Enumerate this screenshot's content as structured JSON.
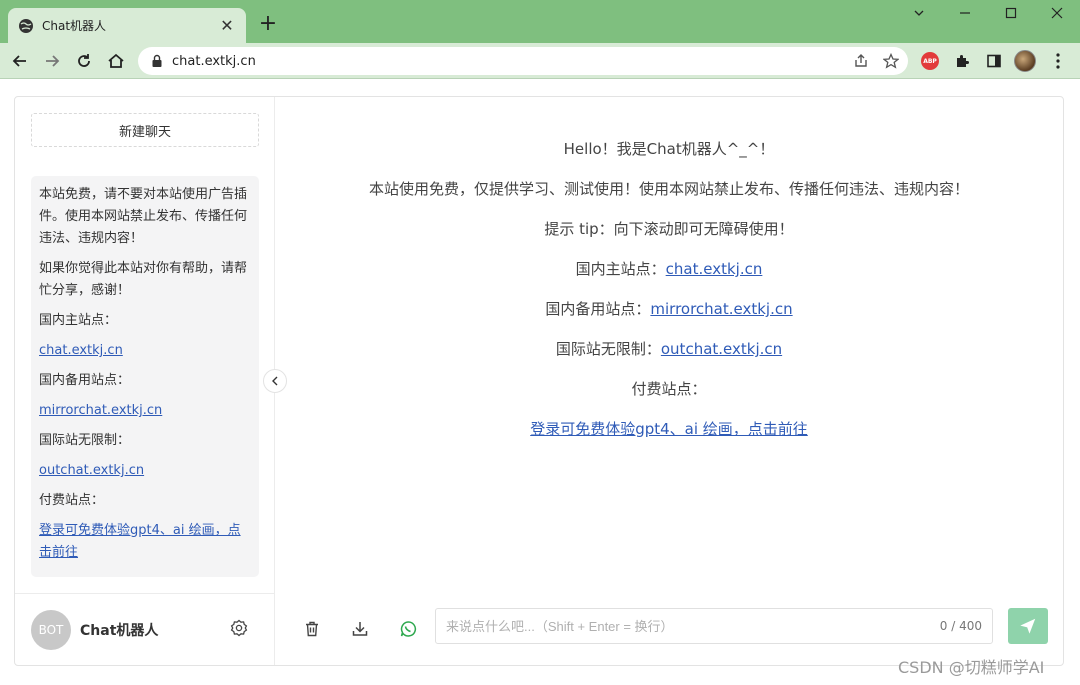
{
  "browser": {
    "tab_title": "Chat机器人",
    "new_tab_symbol": "+",
    "url": "chat.extkj.cn",
    "abp_label": "ABP"
  },
  "sidebar": {
    "new_chat_label": "新建聊天",
    "notice": {
      "p1": "本站免费，请不要对本站使用广告插件。使用本网站禁止发布、传播任何违法、违规内容！",
      "p2": "如果你觉得此本站对你有帮助，请帮忙分享，感谢！",
      "main_site_label": "国内主站点：",
      "main_site_link": "chat.extkj.cn",
      "backup_site_label": "国内备用站点：",
      "backup_site_link": "mirrorchat.extkj.cn",
      "intl_site_label": "国际站无限制：",
      "intl_site_link": "outchat.extkj.cn",
      "paid_site_label": "付费站点：",
      "paid_site_link": "登录可免费体验gpt4、ai 绘画，点击前往"
    },
    "avatar_text": "BOT",
    "bot_name": "Chat机器人"
  },
  "main": {
    "welcome": {
      "hello": "Hello！我是Chat机器人^_^！",
      "free_notice": "本站使用免费，仅提供学习、测试使用！使用本网站禁止发布、传播任何违法、违规内容！",
      "tip": "提示 tip：向下滚动即可无障碍使用！",
      "main_site_label": "国内主站点：",
      "main_site_link": "chat.extkj.cn",
      "backup_site_label": "国内备用站点：",
      "backup_site_link": "mirrorchat.extkj.cn",
      "intl_site_label": "国际站无限制：",
      "intl_site_link": "outchat.extkj.cn",
      "paid_site_label": "付费站点：",
      "paid_site_link": "登录可免费体验gpt4、ai 绘画，点击前往"
    },
    "input": {
      "placeholder": "来说点什么吧...（Shift + Enter = 换行）",
      "value": "",
      "counter": "0 / 400"
    }
  },
  "watermark": "CSDN @切糕师学AI",
  "colors": {
    "tabbar": "#7fbf7f",
    "toolbar": "#d8ebd6",
    "link": "#2f5bb7",
    "send_button": "#8fd3ab",
    "whatsapp_icon": "#2fa84f"
  },
  "icons": [
    "globe-icon",
    "close-icon",
    "minimize-icon",
    "maximize-icon",
    "chevron-down-icon",
    "back-icon",
    "forward-icon",
    "reload-icon",
    "home-icon",
    "lock-icon",
    "share-icon",
    "star-icon",
    "puzzle-icon",
    "sidepanel-icon",
    "menu-icon",
    "chevron-left-icon",
    "gear-icon",
    "trash-icon",
    "download-icon",
    "whatsapp-icon",
    "send-icon"
  ]
}
